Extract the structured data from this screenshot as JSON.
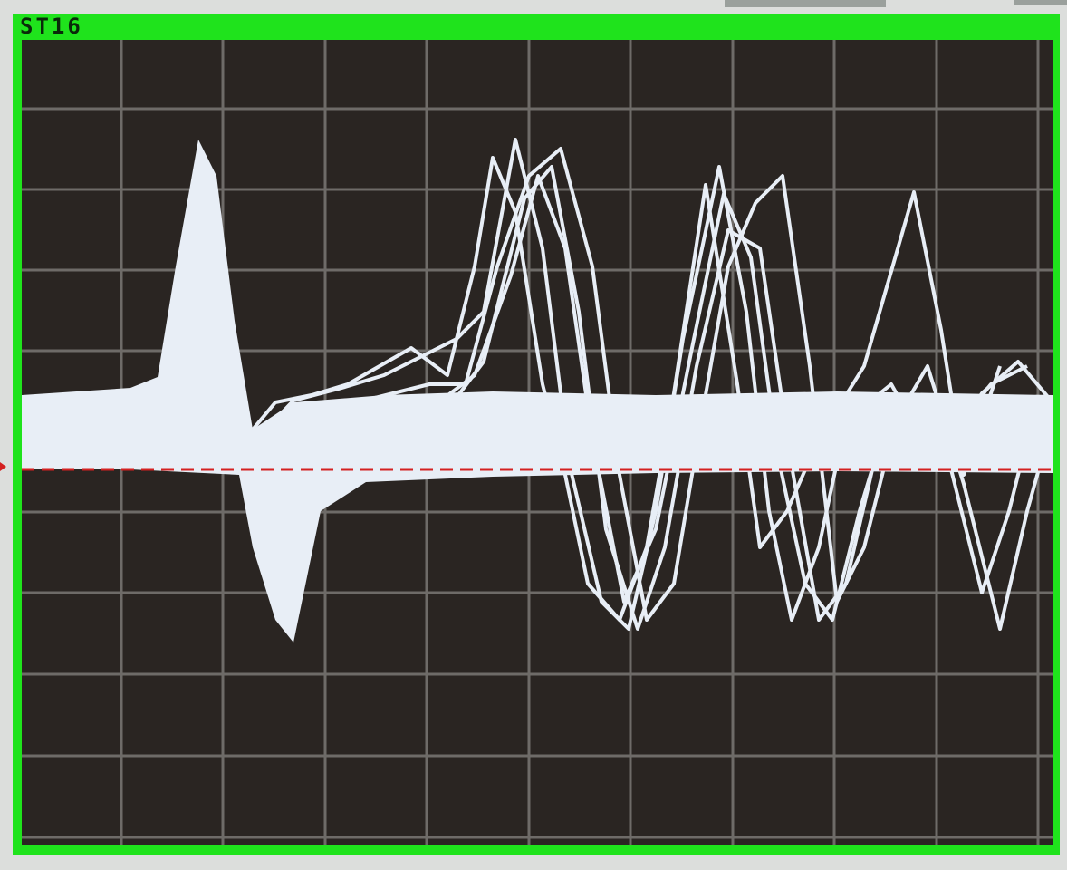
{
  "channel_label": "ST16",
  "colors": {
    "frame": "#1fe31c",
    "screen_bg": "#2a2522",
    "grid": "#6e6b68",
    "trace": "#e8eef6",
    "baseline": "#d42020"
  },
  "icons": {
    "trigger_marker": "trigger-level-arrow-icon"
  }
}
